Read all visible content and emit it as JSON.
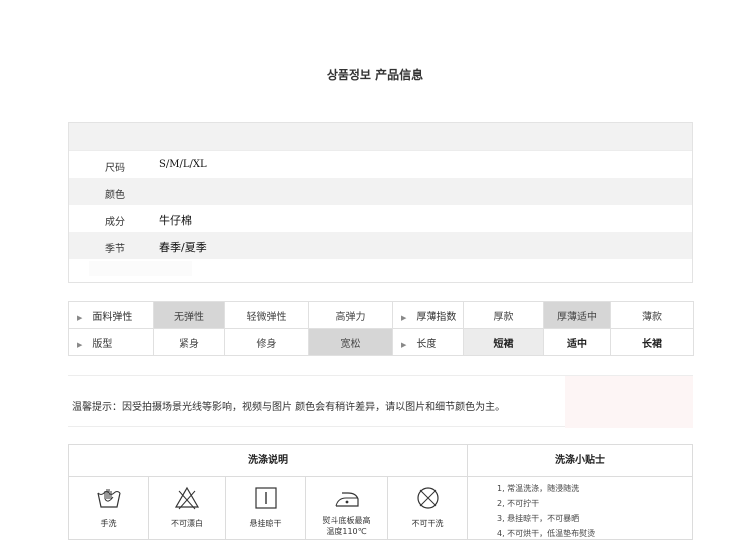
{
  "page_title": {
    "korean": "상품정보",
    "chinese": "产品信息"
  },
  "product_info": {
    "rows": [
      {
        "label": "尺码",
        "value": "S/M/L/XL"
      },
      {
        "label": "颜色",
        "value": ""
      },
      {
        "label": "成分",
        "value": "牛仔棉"
      },
      {
        "label": "季节",
        "value": "春季/夏季"
      }
    ]
  },
  "attributes": {
    "row1": {
      "fabric_label": "面料弹性",
      "fabric_options": [
        "无弹性",
        "轻微弹性",
        "高弹力"
      ],
      "fabric_selected": "无弹性",
      "thickness_label": "厚薄指数",
      "thickness_options": [
        "厚款",
        "厚薄适中",
        "薄款"
      ],
      "thickness_selected": "厚薄适中"
    },
    "row2": {
      "fit_label": "版型",
      "fit_options": [
        "紧身",
        "修身",
        "宽松"
      ],
      "fit_selected": "宽松",
      "length_label": "长度",
      "length_options": [
        "短裙",
        "适中",
        "长裙"
      ],
      "length_selected": "短裙"
    }
  },
  "notice": "温馨提示：因受拍摄场景光线等影响，视频与图片  颜色会有稍许差异，请以图片和细节颜色为主。",
  "care": {
    "instructions_title": "洗涤说明",
    "tips_title": "洗涤小贴士",
    "icons": [
      {
        "icon": "hand-wash-icon",
        "label": "手洗"
      },
      {
        "icon": "no-bleach-icon",
        "label": "不可漂白"
      },
      {
        "icon": "hang-dry-icon",
        "label": "悬挂晾干"
      },
      {
        "icon": "iron-low-temp-icon",
        "label": "熨斗底板最高温度110℃"
      },
      {
        "icon": "no-dry-clean-icon",
        "label": "不可干洗"
      }
    ],
    "icon_labels": [
      "手洗",
      "不可漂白",
      "悬挂晾干",
      "熨斗底板最高",
      "温度110℃",
      "不可干洗"
    ],
    "tips": [
      "1, 常温洗涤，随浸随洗",
      "2, 不可拧干",
      "3, 悬挂晾干，不可暴晒",
      "4, 不可烘干，低温垫布熨烫"
    ]
  }
}
